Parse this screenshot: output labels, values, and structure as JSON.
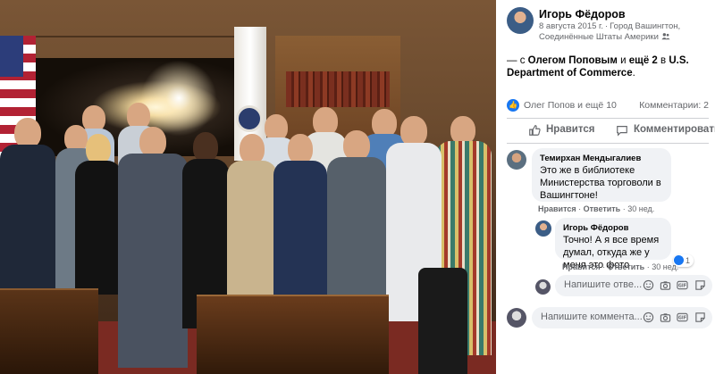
{
  "post": {
    "author": "Игорь Фёдоров",
    "date": "8 августа 2015 г.",
    "location": "Город Вашингтон, Соединённые Штаты Америки",
    "caption": {
      "prefix": "— с",
      "tag1": "Олегом Поповым",
      "and": "и",
      "tag2": "ещё 2",
      "in": "в",
      "place": "U.S. Department of Commerce",
      "suffix": "."
    },
    "reactions_text": "Олег Попов и ещё 10",
    "comments_count": "Комментарии: 2",
    "actions": {
      "like": "Нравится",
      "comment": "Комментировать"
    }
  },
  "comments": [
    {
      "author": "Темирхан Мендыгалиев",
      "text": "Это же в библиотеке Министерства торговоли в Вашингтоне!",
      "like": "Нравится",
      "reply": "Ответить",
      "time": "30 нед."
    },
    {
      "author": "Игорь Фёдоров",
      "text": "Точно! А я все время думал, откуда же у меня это фото",
      "like": "Нравится",
      "reply": "Ответить",
      "time": "30 нед.",
      "likes": "1"
    }
  ],
  "reply_input": {
    "placeholder": "Напишите отве..."
  },
  "comment_input": {
    "placeholder": "Напишите коммента..."
  },
  "colors": {
    "accent": "#1877f2",
    "muted": "#65676b",
    "bubble": "#f0f2f5"
  },
  "icons": [
    "globe-icon",
    "friends-icon",
    "like-icon",
    "comment-icon",
    "emoji-icon",
    "camera-icon",
    "gif-icon",
    "sticker-icon"
  ]
}
